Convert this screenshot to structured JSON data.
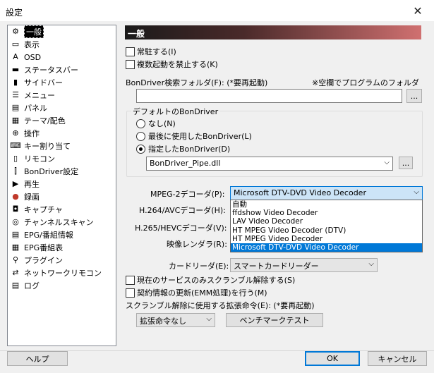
{
  "window": {
    "title": "設定"
  },
  "sidebar": {
    "items": [
      {
        "label": "一般",
        "icon": "gear-icon",
        "glyph": "⚙"
      },
      {
        "label": "表示",
        "icon": "display-icon",
        "glyph": "▭"
      },
      {
        "label": "OSD",
        "icon": "osd-icon",
        "glyph": "A"
      },
      {
        "label": "ステータスバー",
        "icon": "statusbar-icon",
        "glyph": "▬"
      },
      {
        "label": "サイドバー",
        "icon": "sidebar-icon",
        "glyph": "▮"
      },
      {
        "label": "メニュー",
        "icon": "menu-icon",
        "glyph": "☰"
      },
      {
        "label": "パネル",
        "icon": "panel-icon",
        "glyph": "▤"
      },
      {
        "label": "テーマ/配色",
        "icon": "theme-icon",
        "glyph": "▦"
      },
      {
        "label": "操作",
        "icon": "mouse-icon",
        "glyph": "⊕"
      },
      {
        "label": "キー割り当て",
        "icon": "keyboard-icon",
        "glyph": "⌨"
      },
      {
        "label": "リモコン",
        "icon": "remote-icon",
        "glyph": "▯"
      },
      {
        "label": "BonDriver設定",
        "icon": "bondriver-icon",
        "glyph": "⫿"
      },
      {
        "label": "再生",
        "icon": "play-icon",
        "glyph": "▶"
      },
      {
        "label": "録画",
        "icon": "record-icon",
        "glyph": "●"
      },
      {
        "label": "キャプチャ",
        "icon": "camera-icon",
        "glyph": "◘"
      },
      {
        "label": "チャンネルスキャン",
        "icon": "scan-icon",
        "glyph": "◎"
      },
      {
        "label": "EPG/番組情報",
        "icon": "epg-icon",
        "glyph": "▤"
      },
      {
        "label": "EPG番組表",
        "icon": "epg-table-icon",
        "glyph": "▦"
      },
      {
        "label": "プラグイン",
        "icon": "plugin-icon",
        "glyph": "⚲"
      },
      {
        "label": "ネットワークリモコン",
        "icon": "network-remote-icon",
        "glyph": "⇄"
      },
      {
        "label": "ログ",
        "icon": "log-icon",
        "glyph": "▤"
      }
    ]
  },
  "main": {
    "header": "一般",
    "resident_label": "常駐する(I)",
    "no_multi_label": "複数起動を禁止する(K)",
    "bondriver_folder_label": "BonDriver検索フォルダ(F): (*要再起動)",
    "bondriver_folder_note": "※空欄でプログラムのフォルダ",
    "bondriver_folder_value": "",
    "browse_label": "...",
    "default_bondriver_legend": "デフォルトのBonDriver",
    "radio_none": "なし(N)",
    "radio_last": "最後に使用したBonDriver(L)",
    "radio_specified": "指定したBonDriver(D)",
    "bondriver_value": "BonDriver_Pipe.dll",
    "mpeg2_label": "MPEG-2デコーダ(P):",
    "mpeg2_value": "Microsoft DTV-DVD Video Decoder",
    "h264_label": "H.264/AVCデコーダ(H):",
    "h265_label": "H.265/HEVCデコーダ(V):",
    "renderer_label": "映像レンダラ(R):",
    "card_reader_label": "カードリーダ(E):",
    "card_reader_value": "スマートカードリーダー",
    "descramble_current_label": "現在のサービスのみスクランブル解除する(S)",
    "emm_update_label": "契約情報の更新(EMM処理)を行う(M)",
    "descramble_ext_label": "スクランブル解除に使用する拡張命令(E): (*要再起動)",
    "ext_value": "拡張命令なし",
    "benchmark_label": "ベンチマークテスト",
    "dropdown_options": [
      "自動",
      "ffdshow Video Decoder",
      "LAV Video Decoder",
      "HT MPEG Video Decoder (DTV)",
      "HT MPEG Video Decoder",
      "Microsoft DTV-DVD Video Decoder"
    ]
  },
  "footer": {
    "help_label": "ヘルプ",
    "ok_label": "OK",
    "cancel_label": "キャンセル"
  }
}
